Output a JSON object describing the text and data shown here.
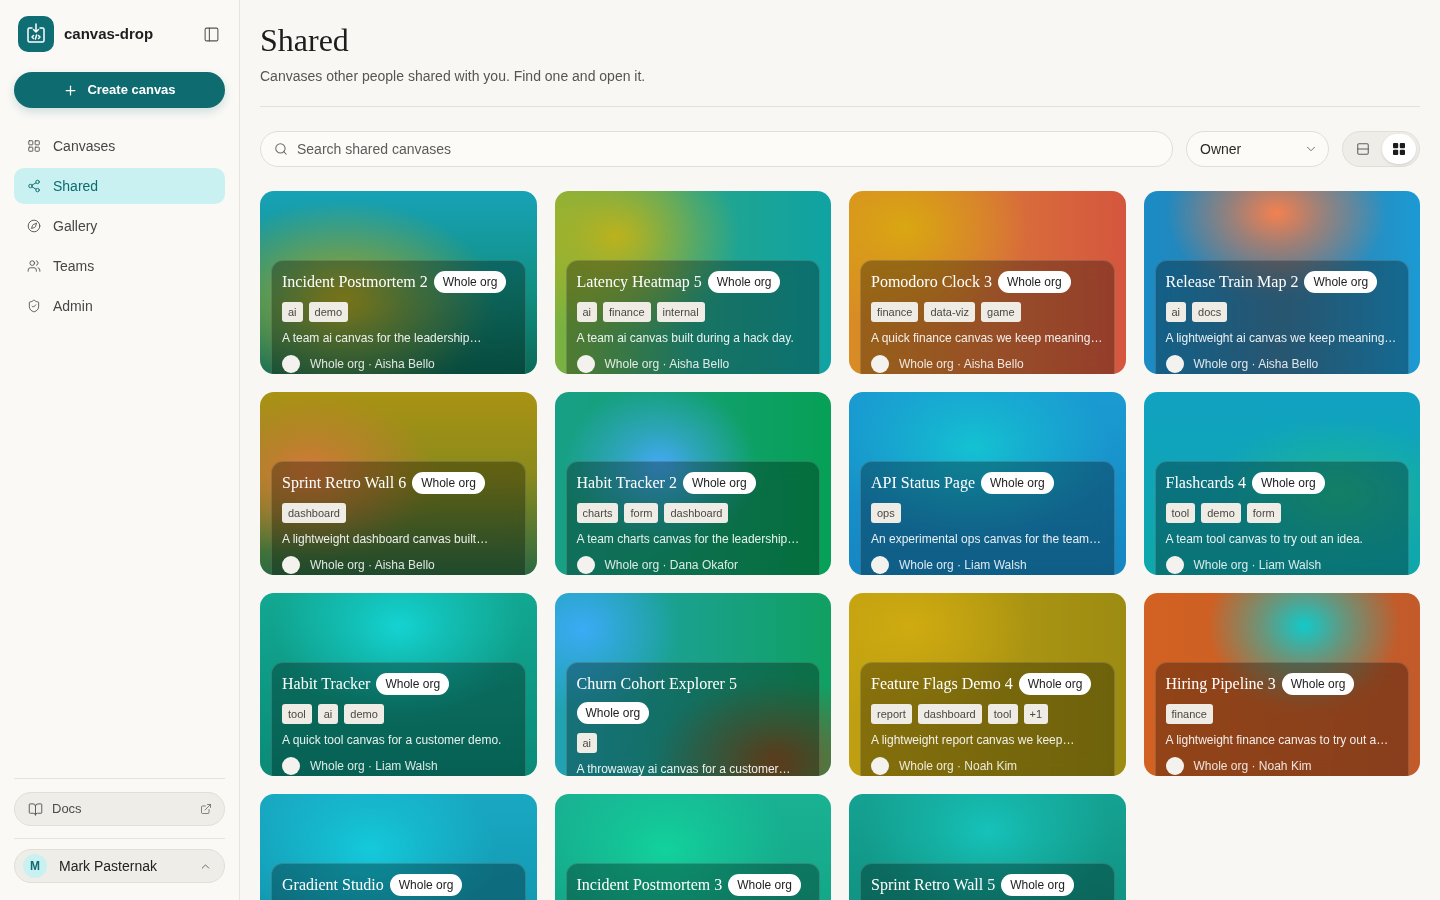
{
  "app": {
    "name": "canvas-drop"
  },
  "sidebar": {
    "create_button": "Create canvas",
    "items": [
      {
        "label": "Canvases",
        "selected": false
      },
      {
        "label": "Shared",
        "selected": true
      },
      {
        "label": "Gallery",
        "selected": false
      },
      {
        "label": "Teams",
        "selected": false
      },
      {
        "label": "Admin",
        "selected": false
      }
    ],
    "docs_link": "Docs",
    "user": {
      "initial": "M",
      "name": "Mark Pasternak"
    }
  },
  "page": {
    "title": "Shared",
    "subtitle": "Canvases other people shared with you. Find one and open it."
  },
  "toolbar": {
    "search": {
      "placeholder": "Search shared canvases"
    },
    "owner_filter": "Owner",
    "view_modes": [
      {
        "kind": "list",
        "selected": false
      },
      {
        "kind": "grid",
        "selected": true
      }
    ]
  },
  "cards": [
    {
      "title": "Incident Postmortem 2",
      "visibility": "Whole org",
      "tags": [
        "ai",
        "demo"
      ],
      "description": "A team ai canvas for the leadership…",
      "footer": "Whole org · Aisha Bello"
    },
    {
      "title": "Latency Heatmap 5",
      "visibility": "Whole org",
      "tags": [
        "ai",
        "finance",
        "internal"
      ],
      "description": "A team ai canvas built during a hack day.",
      "footer": "Whole org · Aisha Bello"
    },
    {
      "title": "Pomodoro Clock 3",
      "visibility": "Whole org",
      "tags": [
        "finance",
        "data-viz",
        "game"
      ],
      "description": "A quick finance canvas we keep meaning…",
      "footer": "Whole org · Aisha Bello"
    },
    {
      "title": "Release Train Map 2",
      "visibility": "Whole org",
      "tags": [
        "ai",
        "docs"
      ],
      "description": "A lightweight ai canvas we keep meaning…",
      "footer": "Whole org · Aisha Bello"
    },
    {
      "title": "Sprint Retro Wall 6",
      "visibility": "Whole org",
      "tags": [
        "dashboard"
      ],
      "description": "A lightweight dashboard canvas built…",
      "footer": "Whole org · Aisha Bello"
    },
    {
      "title": "Habit Tracker 2",
      "visibility": "Whole org",
      "tags": [
        "charts",
        "form",
        "dashboard"
      ],
      "description": "A team charts canvas for the leadership…",
      "footer": "Whole org · Dana Okafor"
    },
    {
      "title": "API Status Page",
      "visibility": "Whole org",
      "tags": [
        "ops"
      ],
      "description": "An experimental ops canvas for the team…",
      "footer": "Whole org · Liam Walsh"
    },
    {
      "title": "Flashcards 4",
      "visibility": "Whole org",
      "tags": [
        "tool",
        "demo",
        "form"
      ],
      "description": "A team tool canvas to try out an idea.",
      "footer": "Whole org · Liam Walsh"
    },
    {
      "title": "Habit Tracker",
      "visibility": "Whole org",
      "tags": [
        "tool",
        "ai",
        "demo"
      ],
      "description": "A quick tool canvas for a customer demo.",
      "footer": "Whole org · Liam Walsh"
    },
    {
      "title": "Churn Cohort Explorer 5",
      "visibility": "Whole org",
      "tags": [
        "ai"
      ],
      "description": "A throwaway ai canvas for a customer…"
    },
    {
      "title": "Feature Flags Demo 4",
      "visibility": "Whole org",
      "tags": [
        "report",
        "dashboard",
        "tool",
        "+1"
      ],
      "description": "A lightweight report canvas we keep…",
      "footer": "Whole org · Noah Kim"
    },
    {
      "title": "Hiring Pipeline 3",
      "visibility": "Whole org",
      "tags": [
        "finance"
      ],
      "description": "A lightweight finance canvas to try out a…",
      "footer": "Whole org · Noah Kim"
    },
    {
      "title": "Gradient Studio",
      "visibility": "Whole org"
    },
    {
      "title": "Incident Postmortem 3",
      "visibility": "Whole org"
    },
    {
      "title": "Sprint Retro Wall 5",
      "visibility": "Whole org"
    }
  ]
}
